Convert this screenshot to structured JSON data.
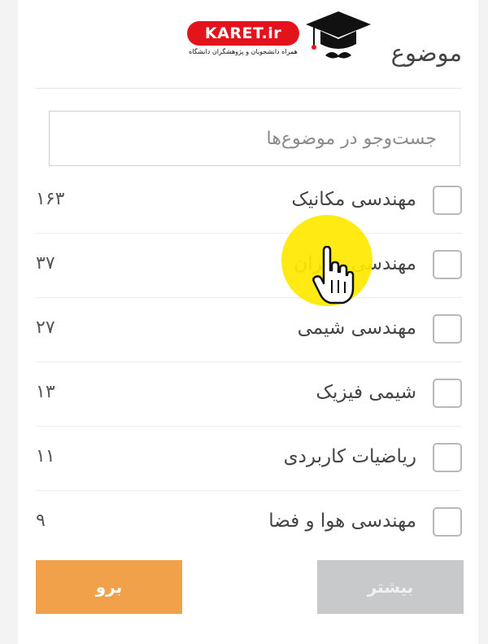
{
  "header": {
    "title": "موضوع",
    "logo": {
      "brand_text": "KARET.ir",
      "tagline": "همراه دانشجویان و پژوهشگران دانشگاه",
      "icon": "graduation-cap-mustache-icon"
    }
  },
  "search": {
    "placeholder": "جست‌وجو در موضوع‌ها",
    "value": ""
  },
  "filters": [
    {
      "label": "مهندسی مکانیک",
      "count": "۱۶۳",
      "checked": false
    },
    {
      "label": "مهندسی عمران",
      "count": "۳۷",
      "checked": false
    },
    {
      "label": "مهندسی شیمی",
      "count": "۲۷",
      "checked": false
    },
    {
      "label": "شیمی فیزیک",
      "count": "۱۳",
      "checked": false
    },
    {
      "label": "ریاضیات کاربردی",
      "count": "۱۱",
      "checked": false
    },
    {
      "label": "مهندسی هوا و فضا",
      "count": "۹",
      "checked": false
    }
  ],
  "buttons": {
    "go_label": "برو",
    "more_label": "بیشتر"
  },
  "colors": {
    "go_button": "#f0a14a",
    "more_button": "#c7c9cb",
    "logo_red": "#e3131b",
    "cursor_highlight": "#ffe800"
  },
  "cursor": {
    "icon": "hand-pointer-icon",
    "hovering": "مهندسی عمران"
  }
}
